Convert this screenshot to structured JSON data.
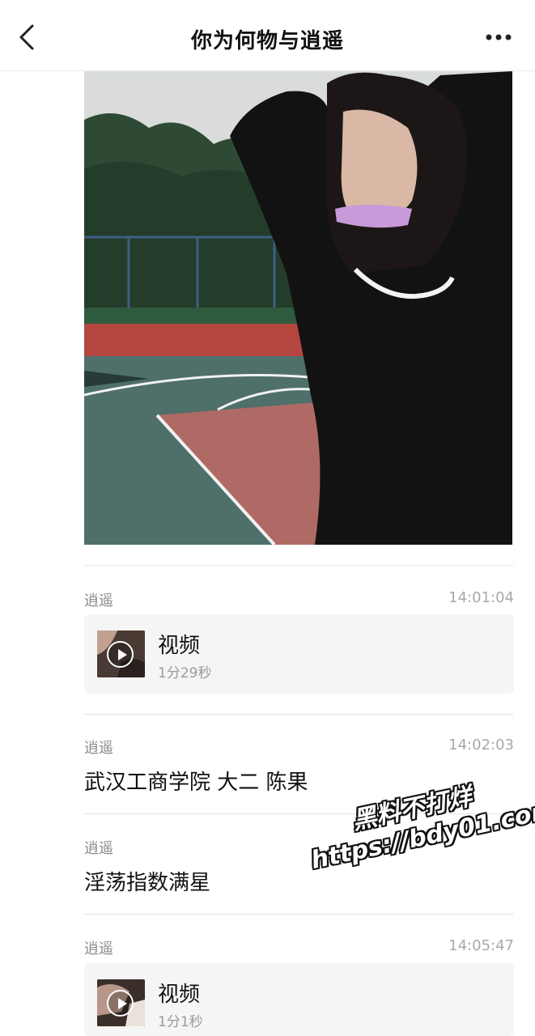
{
  "header": {
    "title": "你为何物与逍遥",
    "back_icon": "chevron-left-icon",
    "more_icon": "more-horizontal-icon"
  },
  "messages": [
    {
      "sender": "逍遥",
      "time": "14:01:04",
      "type": "video",
      "video_title": "视频",
      "duration": "1分29秒"
    },
    {
      "sender": "逍遥",
      "time": "14:02:03",
      "type": "text",
      "text": "武汉工商学院 大二 陈果"
    },
    {
      "sender": "逍遥",
      "time": "",
      "type": "text",
      "text": "淫荡指数满星"
    },
    {
      "sender": "逍遥",
      "time": "14:05:47",
      "type": "video",
      "video_title": "视频",
      "duration": "1分1秒"
    }
  ],
  "watermark": {
    "line1": "黑料不打烊",
    "line2": "https://bdy01.com"
  },
  "colors": {
    "card_bg": "#f5f5f5",
    "meta_text": "#8a8a8a",
    "time_text": "#a9a9a9"
  }
}
